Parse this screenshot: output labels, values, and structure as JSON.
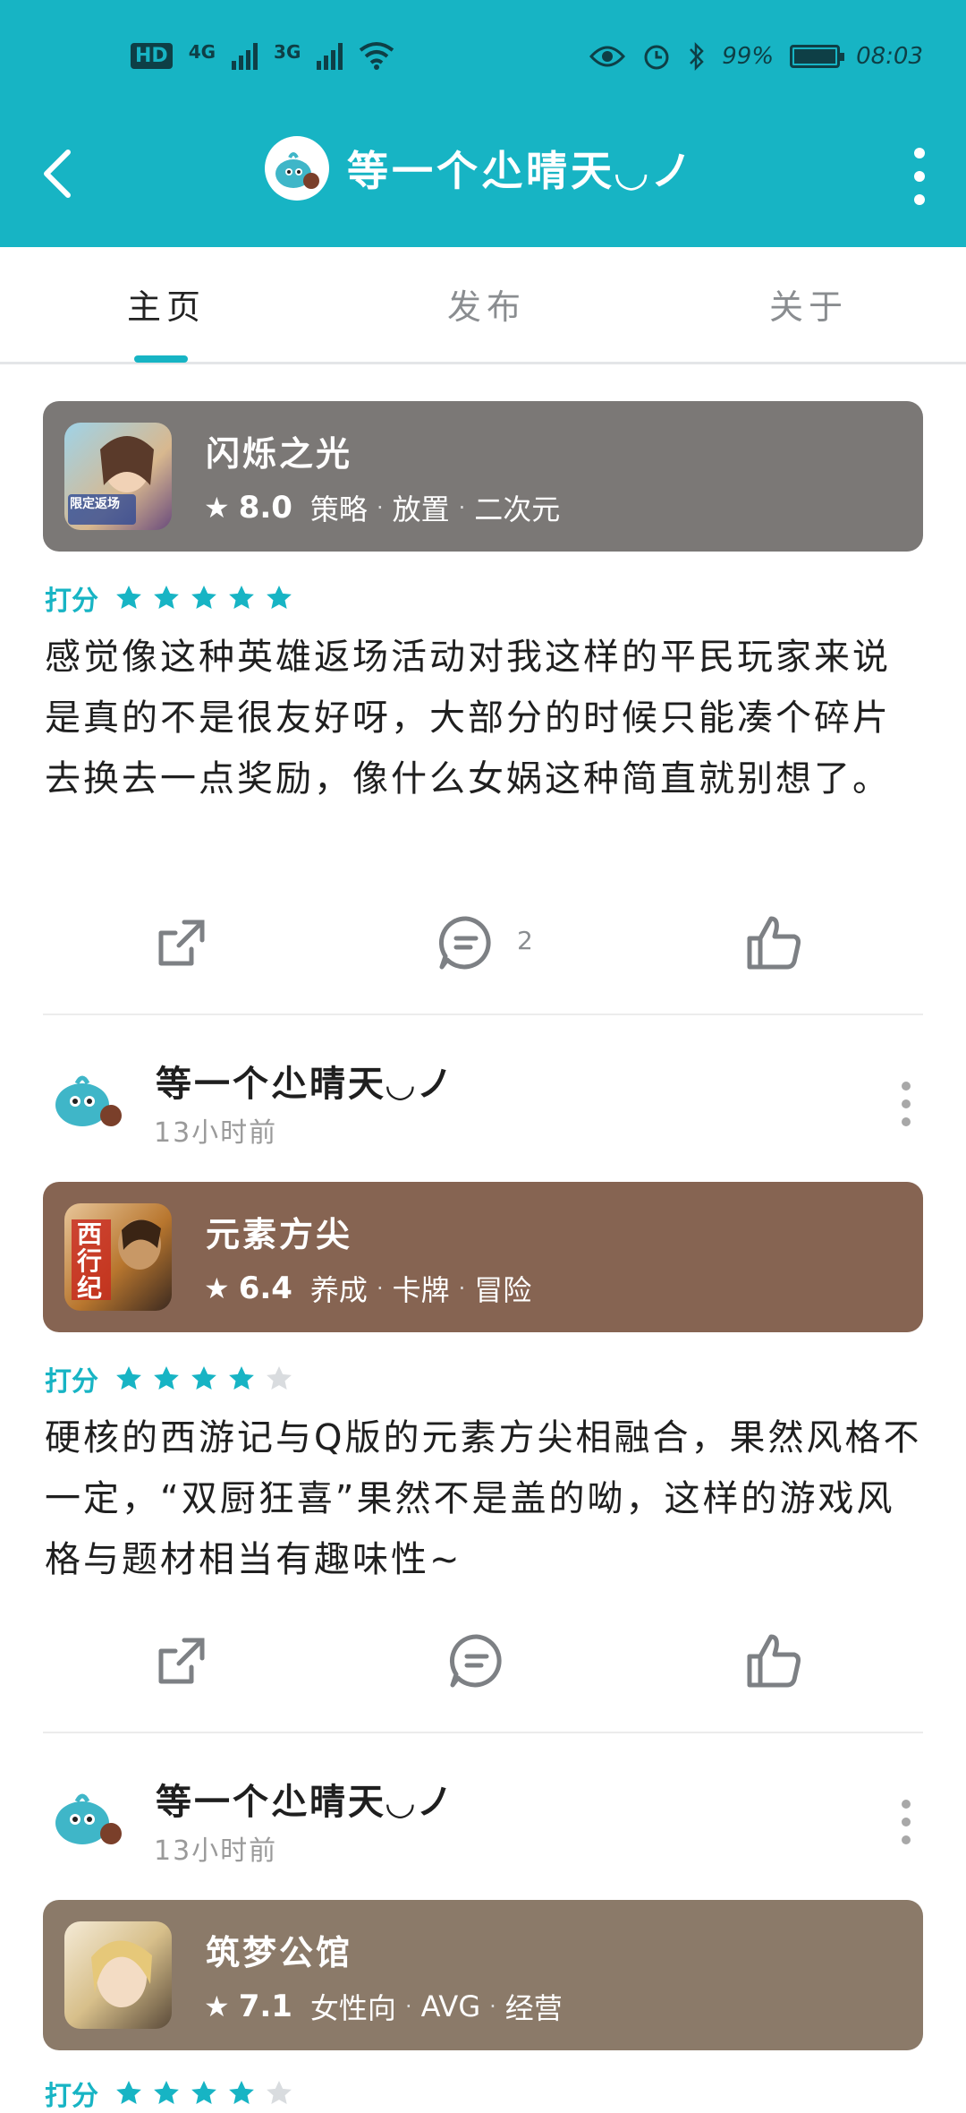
{
  "status_bar": {
    "hd": "HD",
    "net1": "4G",
    "net2": "3G",
    "battery_text": "99%",
    "battery_level": 0.99,
    "time": "08:03"
  },
  "header": {
    "title": "等一个尐晴天◡ノ",
    "avatar_icon": "blue-slime-avatar",
    "back_icon": "back-arrow-icon",
    "menu_icon": "more-vert-icon"
  },
  "tabs": [
    {
      "label": "主页",
      "active": true
    },
    {
      "label": "发布",
      "active": false
    },
    {
      "label": "关于",
      "active": false
    }
  ],
  "colors": {
    "brand": "#17b4c4",
    "card1": "#7b7876",
    "card2": "#866452",
    "card3": "#8b7a69",
    "star_on": "#17b4c4",
    "star_off": "#d9dcdf"
  },
  "posts": [
    {
      "game": {
        "name": "闪烁之光",
        "score": "8.0",
        "tags": [
          "策略",
          "放置",
          "二次元"
        ],
        "icon_text": "限定返场"
      },
      "rating_label": "打分",
      "stars": 5,
      "review": "感觉像这种英雄返场活动对我这样的平民玩家来说是真的不是很友好呀，大部分的时候只能凑个碎片去换去一点奖励，像什么女娲这种简直就别想了。",
      "comment_count": "2"
    },
    {
      "author": {
        "name": "等一个尐晴天◡ノ",
        "time": "13小时前"
      },
      "game": {
        "name": "元素方尖",
        "score": "6.4",
        "tags": [
          "养成",
          "卡牌",
          "冒险"
        ],
        "icon_text": "西行纪"
      },
      "rating_label": "打分",
      "stars": 4,
      "review": "硬核的西游记与Q版的元素方尖相融合，果然风格不一定，“双厨狂喜”果然不是盖的呦，这样的游戏风格与题材相当有趣味性~",
      "comment_count": ""
    },
    {
      "author": {
        "name": "等一个尐晴天◡ノ",
        "time": "13小时前"
      },
      "game": {
        "name": "筑梦公馆",
        "score": "7.1",
        "tags": [
          "女性向",
          "AVG",
          "经营"
        ],
        "icon_text": ""
      },
      "rating_label": "打分",
      "stars": 4
    }
  ]
}
